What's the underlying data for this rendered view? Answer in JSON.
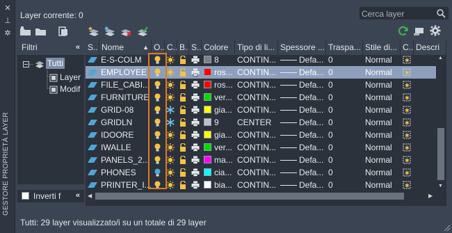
{
  "palette": {
    "window_bg": "#3b4453",
    "list_bg": "#2c323c",
    "selection": "#8d9fbc",
    "highlight_outline": "#e07a1f",
    "bulb_on": "#f5c343",
    "bulb_off": "#4fa6d6",
    "refresh_green": "#3fb34f"
  },
  "window": {
    "title_vertical": "GESTORE PROPRIETÀ LAYER",
    "current_layer_label": "Layer corrente: 0",
    "status_text": "Tutti: 29 layer visualizzato/i su un totale di 29 layer"
  },
  "search": {
    "placeholder": "Cerca layer"
  },
  "toolbar": {
    "left_icons": [
      "new-property-filter-icon",
      "new-group-filter-icon",
      "layer-states-manager-icon"
    ],
    "layer_icons": [
      "new-layer-icon",
      "new-layer-vp-frozen-icon",
      "delete-layer-icon",
      "set-current-icon"
    ],
    "right_icons": [
      "refresh-icon",
      "settings-toggle-icon",
      "gear-icon"
    ]
  },
  "filters": {
    "header": "Filtri",
    "tree": [
      {
        "label": "Tutti",
        "level": 0,
        "selected": true
      },
      {
        "label": "Layer",
        "level": 1
      },
      {
        "label": "Modif",
        "level": 1
      }
    ],
    "invert_label": "Inverti f"
  },
  "columns": [
    {
      "key": "status",
      "label": "S.."
    },
    {
      "key": "name",
      "label": "Nome",
      "sorted": "asc"
    },
    {
      "key": "on",
      "label": "O.."
    },
    {
      "key": "freeze",
      "label": "C.."
    },
    {
      "key": "lock",
      "label": "B.."
    },
    {
      "key": "plot",
      "label": "S.."
    },
    {
      "key": "color",
      "label": "Colore"
    },
    {
      "key": "linetype",
      "label": "Tipo di li..."
    },
    {
      "key": "lineweight",
      "label": "Spessore ..."
    },
    {
      "key": "transparency",
      "label": "Traspa..."
    },
    {
      "key": "plotstyle",
      "label": "Stile di..."
    },
    {
      "key": "newvp",
      "label": "C.."
    },
    {
      "key": "description",
      "label": "Descri"
    }
  ],
  "layers": [
    {
      "name": "E-S-COLM",
      "on": true,
      "frozen": false,
      "color_name": "8",
      "color": "#808080",
      "linetype": "CONTIN...",
      "lineweight": "Defa...",
      "transparency": "0",
      "plot_style": "Normal",
      "partial": true
    },
    {
      "name": "EMPLOYEE",
      "on": true,
      "frozen": false,
      "color_name": "ros...",
      "color": "#ff0000",
      "linetype": "CONTIN...",
      "lineweight": "Defa...",
      "transparency": "0",
      "plot_style": "Normal",
      "selected": true
    },
    {
      "name": "FILE_CABI...",
      "on": true,
      "frozen": false,
      "color_name": "ros...",
      "color": "#ff0000",
      "linetype": "CONTIN...",
      "lineweight": "Defa...",
      "transparency": "0",
      "plot_style": "Normal"
    },
    {
      "name": "FURNITURE",
      "on": true,
      "frozen": false,
      "color_name": "ver...",
      "color": "#00dd00",
      "linetype": "CONTIN...",
      "lineweight": "Defa...",
      "transparency": "0",
      "plot_style": "Normal"
    },
    {
      "name": "GRID-08",
      "on": true,
      "frozen": true,
      "color_name": "gia...",
      "color": "#ffff00",
      "linetype": "CONTIN...",
      "lineweight": "Defa...",
      "transparency": "0",
      "plot_style": "Normal"
    },
    {
      "name": "GRIDLN",
      "on": true,
      "frozen": true,
      "color_name": "9",
      "color": "#c0c0c0",
      "linetype": "CENTER",
      "lineweight": "Defa...",
      "transparency": "0",
      "plot_style": "Normal"
    },
    {
      "name": "IDOORE",
      "on": true,
      "frozen": false,
      "color_name": "gia...",
      "color": "#ffff00",
      "linetype": "CONTIN...",
      "lineweight": "Defa...",
      "transparency": "0",
      "plot_style": "Normal"
    },
    {
      "name": "IWALLE",
      "on": true,
      "frozen": false,
      "color_name": "ver...",
      "color": "#00dd00",
      "linetype": "CONTIN...",
      "lineweight": "Defa...",
      "transparency": "0",
      "plot_style": "Normal"
    },
    {
      "name": "PANELS_2...",
      "on": true,
      "frozen": false,
      "color_name": "ma...",
      "color": "#ff00ff",
      "linetype": "CONTIN...",
      "lineweight": "Defa...",
      "transparency": "0",
      "plot_style": "Normal"
    },
    {
      "name": "PHONES",
      "on": false,
      "frozen": false,
      "color_name": "cia...",
      "color": "#00ffff",
      "linetype": "CONTIN...",
      "lineweight": "Defa...",
      "transparency": "0",
      "plot_style": "Normal"
    },
    {
      "name": "PRINTER_I...",
      "on": true,
      "frozen": false,
      "color_name": "bia...",
      "color": "#ffffff",
      "linetype": "CONTIN...",
      "lineweight": "Defa...",
      "transparency": "0",
      "plot_style": "Normal"
    }
  ]
}
